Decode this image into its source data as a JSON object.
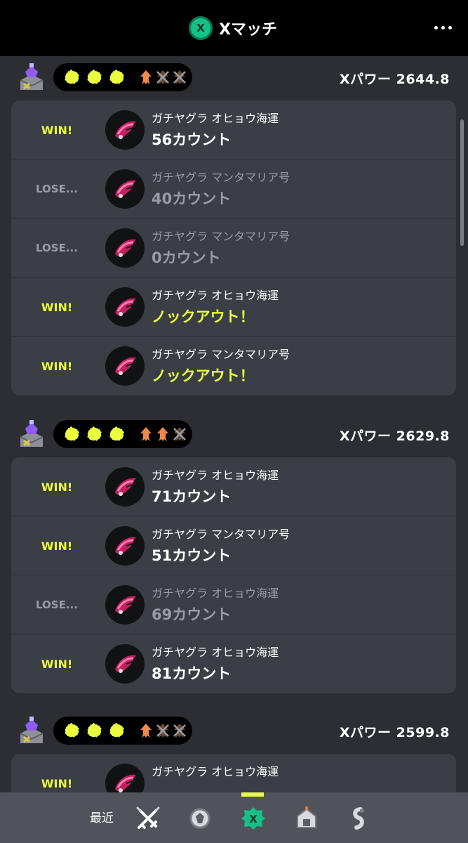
{
  "header": {
    "title": "Xマッチ",
    "badge_letter": "X",
    "more_icon": "more-dots-icon"
  },
  "colors": {
    "accent": "#eaff3d",
    "lose_gray": "#9a9ca3",
    "header_bg": "#000000",
    "card_bg": "#3b3e45",
    "page_bg": "#2c2e34",
    "nav_bg": "#50535a",
    "splat_yellow": "#eaff3d",
    "squid_orange": "#f08a4b",
    "x_green": "#16c089"
  },
  "groups": [
    {
      "power": "Xパワー 2644.8",
      "splats": 3,
      "squids": [
        "alive",
        "dead",
        "dead"
      ],
      "matches": [
        {
          "result": "WIN!",
          "stage": "ガチヤグラ オヒョウ海運",
          "score": "56カウント",
          "win": true,
          "ko": false
        },
        {
          "result": "LOSE...",
          "stage": "ガチヤグラ マンタマリア号",
          "score": "40カウント",
          "win": false,
          "ko": false
        },
        {
          "result": "LOSE...",
          "stage": "ガチヤグラ マンタマリア号",
          "score": "0カウント",
          "win": false,
          "ko": false
        },
        {
          "result": "WIN!",
          "stage": "ガチヤグラ オヒョウ海運",
          "score": "ノックアウト！",
          "win": true,
          "ko": true
        },
        {
          "result": "WIN!",
          "stage": "ガチヤグラ マンタマリア号",
          "score": "ノックアウト！",
          "win": true,
          "ko": true
        }
      ]
    },
    {
      "power": "Xパワー 2629.8",
      "splats": 3,
      "squids": [
        "alive",
        "alive",
        "dead"
      ],
      "matches": [
        {
          "result": "WIN!",
          "stage": "ガチヤグラ オヒョウ海運",
          "score": "71カウント",
          "win": true,
          "ko": false
        },
        {
          "result": "WIN!",
          "stage": "ガチヤグラ マンタマリア号",
          "score": "51カウント",
          "win": true,
          "ko": false
        },
        {
          "result": "LOSE...",
          "stage": "ガチヤグラ オヒョウ海運",
          "score": "69カウント",
          "win": false,
          "ko": false
        },
        {
          "result": "WIN!",
          "stage": "ガチヤグラ オヒョウ海運",
          "score": "81カウント",
          "win": true,
          "ko": false
        }
      ]
    },
    {
      "power": "Xパワー 2599.8",
      "splats": 3,
      "squids": [
        "alive",
        "dead",
        "dead"
      ],
      "matches": [
        {
          "result": "WIN!",
          "stage": "ガチヤグラ オヒョウ海運",
          "score": "",
          "win": true,
          "ko": false
        }
      ]
    }
  ],
  "bottom_nav": {
    "label": "最近",
    "items": [
      {
        "icon": "recent-battles-icon"
      },
      {
        "icon": "bankara-match-icon"
      },
      {
        "icon": "x-match-icon"
      },
      {
        "icon": "private-battle-icon"
      },
      {
        "icon": "turf-war-icon"
      }
    ],
    "active_index": 2
  }
}
